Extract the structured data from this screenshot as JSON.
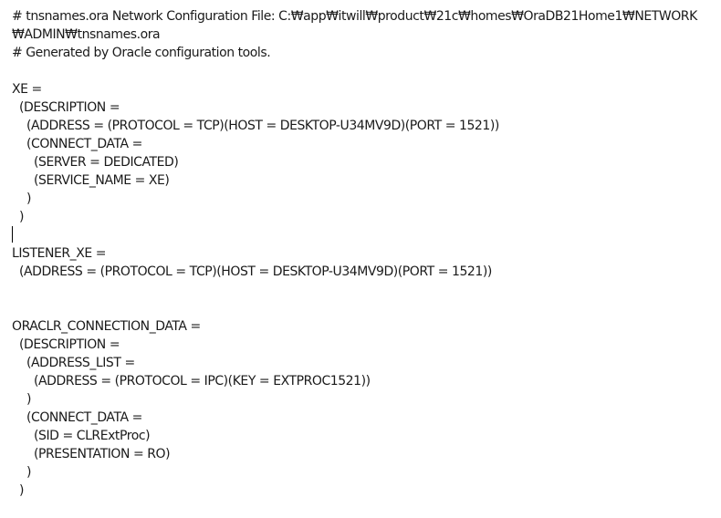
{
  "editor": {
    "lines": [
      "# tnsnames.ora Network Configuration File: C:₩app₩itwill₩product₩21c₩homes₩OraDB21Home1₩NETWORK",
      "₩ADMIN₩tnsnames.ora",
      "# Generated by Oracle configuration tools.",
      "",
      "XE =",
      "  (DESCRIPTION =",
      "    (ADDRESS = (PROTOCOL = TCP)(HOST = DESKTOP-U34MV9D)(PORT = 1521))",
      "    (CONNECT_DATA =",
      "      (SERVER = DEDICATED)",
      "      (SERVICE_NAME = XE)",
      "    )",
      "  )",
      "",
      "LISTENER_XE =",
      "  (ADDRESS = (PROTOCOL = TCP)(HOST = DESKTOP-U34MV9D)(PORT = 1521))",
      "",
      "",
      "ORACLR_CONNECTION_DATA =",
      "  (DESCRIPTION =",
      "    (ADDRESS_LIST =",
      "      (ADDRESS = (PROTOCOL = IPC)(KEY = EXTPROC1521))",
      "    )",
      "    (CONNECT_DATA =",
      "      (SID = CLRExtProc)",
      "      (PRESENTATION = RO)",
      "    )",
      "  )"
    ]
  }
}
